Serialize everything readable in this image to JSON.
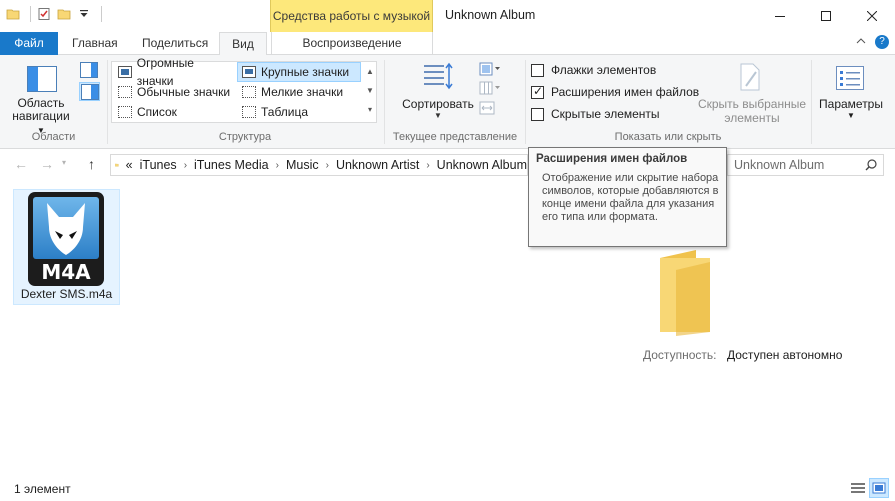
{
  "window": {
    "title": "Unknown Album",
    "context_tab_header": "Средства работы с музыкой"
  },
  "tabs": {
    "file": "Файл",
    "home": "Главная",
    "share": "Поделиться",
    "view": "Вид",
    "playback": "Воспроизведение"
  },
  "ribbon": {
    "panes": {
      "nav_pane_line1": "Область",
      "nav_pane_line2": "навигации",
      "group_label": "Области"
    },
    "layout": {
      "items": [
        "Огромные значки",
        "Крупные значки",
        "Обычные значки",
        "Мелкие значки",
        "Список",
        "Таблица"
      ],
      "selected": "Крупные значки",
      "group_label": "Структура"
    },
    "current_view": {
      "sort_label": "Сортировать",
      "group_label": "Текущее представление"
    },
    "show_hide": {
      "item_checkboxes": "Флажки элементов",
      "file_extensions": "Расширения имен файлов",
      "hidden_items": "Скрытые элементы",
      "hide_selected_line1": "Скрыть выбранные",
      "hide_selected_line2": "элементы",
      "group_label": "Показать или скрыть",
      "item_checkboxes_checked": false,
      "file_extensions_checked": true,
      "hidden_items_checked": false
    },
    "options": {
      "label": "Параметры"
    }
  },
  "address": {
    "overflow": "«",
    "crumbs": [
      "iTunes",
      "iTunes Media",
      "Music",
      "Unknown Artist",
      "Unknown Album"
    ],
    "search_placeholder": "Unknown Album"
  },
  "files": [
    {
      "name": "Dexter SMS.m4a",
      "badge": "M4A"
    }
  ],
  "details": {
    "availability_label": "Доступность:",
    "availability_value": "Доступен автономно"
  },
  "status": {
    "count": "1 элемент"
  },
  "tooltip": {
    "title": "Расширения имен файлов",
    "body": "Отображение или скрытие набора символов, которые добавляются в конце имени файла для указания его типа или формата."
  },
  "colors": {
    "accent": "#1979ca",
    "context_tab": "#fde87b",
    "selection": "#cce8ff",
    "folder": "#f8d775"
  }
}
